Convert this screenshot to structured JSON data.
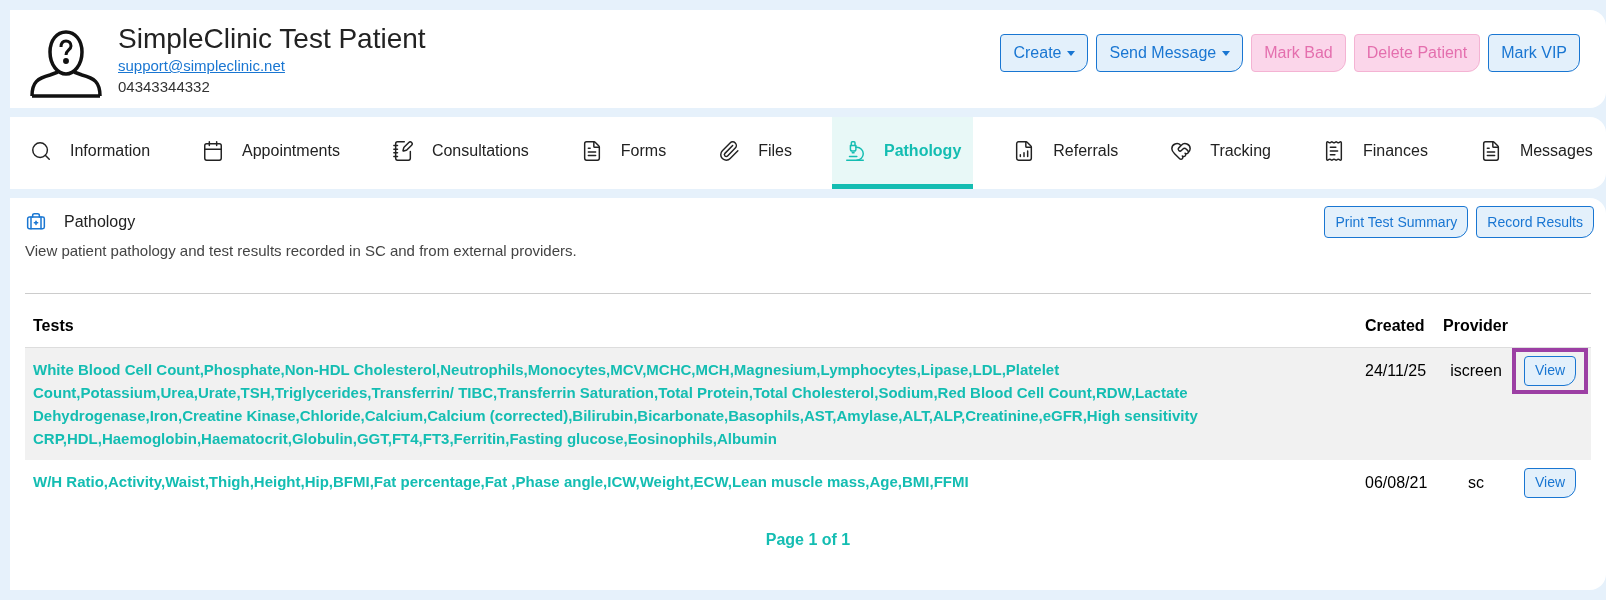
{
  "patient": {
    "name": "SimpleClinic Test Patient",
    "email": "support@simpleclinic.net",
    "phone": "04343344332"
  },
  "actions": [
    {
      "label": "Create",
      "kind": "dropdown"
    },
    {
      "label": "Send Message",
      "kind": "dropdown"
    },
    {
      "label": "Mark Bad",
      "kind": "danger"
    },
    {
      "label": "Delete Patient",
      "kind": "danger"
    },
    {
      "label": "Mark VIP",
      "kind": "plain"
    }
  ],
  "tabs": [
    {
      "label": "Information",
      "selected": false
    },
    {
      "label": "Appointments",
      "selected": false
    },
    {
      "label": "Consultations",
      "selected": false
    },
    {
      "label": "Forms",
      "selected": false
    },
    {
      "label": "Files",
      "selected": false
    },
    {
      "label": "Pathology",
      "selected": true
    },
    {
      "label": "Referrals",
      "selected": false
    },
    {
      "label": "Tracking",
      "selected": false
    },
    {
      "label": "Finances",
      "selected": false
    },
    {
      "label": "Messages",
      "selected": false
    }
  ],
  "section": {
    "title": "Pathology",
    "description": "View patient pathology and test results recorded in SC and from external providers.",
    "buttons": [
      "Print Test Summary",
      "Record Results"
    ]
  },
  "table": {
    "columns": [
      "Tests",
      "Created",
      "Provider"
    ],
    "rows": [
      {
        "tests": "White Blood Cell Count,Phosphate,Non-HDL Cholesterol,Neutrophils,Monocytes,MCV,MCHC,MCH,Magnesium,Lymphocytes,Lipase,LDL,Platelet Count,Potassium,Urea,Urate,TSH,Triglycerides,Transferrin/ TIBC,Transferrin Saturation,Total Protein,Total Cholesterol,Sodium,Red Blood Cell Count,RDW,Lactate Dehydrogenase,Iron,Creatine Kinase,Chloride,Calcium,Calcium (corrected),Bilirubin,Bicarbonate,Basophils,AST,Amylase,ALT,ALP,Creatinine,eGFR,High sensitivity CRP,HDL,Haemoglobin,Haematocrit,Globulin,GGT,FT4,FT3,Ferritin,Fasting glucose,Eosinophils,Albumin",
        "created": "24/11/25",
        "provider": "iscreen",
        "action": "View",
        "shaded": true,
        "highlighted": true
      },
      {
        "tests": "W/H Ratio,Activity,Waist,Thigh,Height,Hip,BFMI,Fat percentage,Fat ,Phase angle,ICW,Weight,ECW,Lean muscle mass,Age,BMI,FFMI",
        "created": "06/08/21",
        "provider": "sc",
        "action": "View",
        "shaded": false,
        "highlighted": false
      }
    ]
  },
  "pagination": "Page 1 of 1"
}
